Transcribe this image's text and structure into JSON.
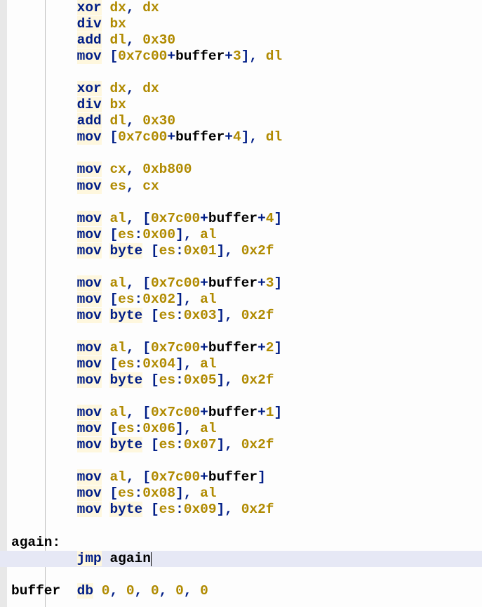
{
  "lines": [
    {
      "indent": 2,
      "tokens": [
        {
          "t": "xor",
          "c": "kw"
        },
        {
          "t": " "
        },
        {
          "t": "dx",
          "c": "reg"
        },
        {
          "t": ",",
          "c": "sym"
        },
        {
          "t": " "
        },
        {
          "t": "dx",
          "c": "reg"
        }
      ]
    },
    {
      "indent": 2,
      "tokens": [
        {
          "t": "div",
          "c": "kw"
        },
        {
          "t": " "
        },
        {
          "t": "bx",
          "c": "reg"
        }
      ]
    },
    {
      "indent": 2,
      "tokens": [
        {
          "t": "add",
          "c": "kw"
        },
        {
          "t": " "
        },
        {
          "t": "dl",
          "c": "reg"
        },
        {
          "t": ",",
          "c": "sym"
        },
        {
          "t": " "
        },
        {
          "t": "0x30",
          "c": "num"
        }
      ]
    },
    {
      "indent": 2,
      "tokens": [
        {
          "t": "mov",
          "c": "kw"
        },
        {
          "t": " "
        },
        {
          "t": "[",
          "c": "sym"
        },
        {
          "t": "0x7c00",
          "c": "num"
        },
        {
          "t": "+",
          "c": "sym"
        },
        {
          "t": "buffer",
          "c": "id"
        },
        {
          "t": "+",
          "c": "sym"
        },
        {
          "t": "3",
          "c": "num"
        },
        {
          "t": "],",
          "c": "sym"
        },
        {
          "t": " "
        },
        {
          "t": "dl",
          "c": "reg"
        }
      ]
    },
    {
      "indent": 0,
      "tokens": []
    },
    {
      "indent": 2,
      "tokens": [
        {
          "t": "xor",
          "c": "kw"
        },
        {
          "t": " "
        },
        {
          "t": "dx",
          "c": "reg"
        },
        {
          "t": ",",
          "c": "sym"
        },
        {
          "t": " "
        },
        {
          "t": "dx",
          "c": "reg"
        }
      ]
    },
    {
      "indent": 2,
      "tokens": [
        {
          "t": "div",
          "c": "kw"
        },
        {
          "t": " "
        },
        {
          "t": "bx",
          "c": "reg"
        }
      ]
    },
    {
      "indent": 2,
      "tokens": [
        {
          "t": "add",
          "c": "kw"
        },
        {
          "t": " "
        },
        {
          "t": "dl",
          "c": "reg"
        },
        {
          "t": ",",
          "c": "sym"
        },
        {
          "t": " "
        },
        {
          "t": "0x30",
          "c": "num"
        }
      ]
    },
    {
      "indent": 2,
      "tokens": [
        {
          "t": "mov",
          "c": "kw"
        },
        {
          "t": " "
        },
        {
          "t": "[",
          "c": "sym"
        },
        {
          "t": "0x7c00",
          "c": "num"
        },
        {
          "t": "+",
          "c": "sym"
        },
        {
          "t": "buffer",
          "c": "id"
        },
        {
          "t": "+",
          "c": "sym"
        },
        {
          "t": "4",
          "c": "num"
        },
        {
          "t": "],",
          "c": "sym"
        },
        {
          "t": " "
        },
        {
          "t": "dl",
          "c": "reg"
        }
      ]
    },
    {
      "indent": 0,
      "tokens": []
    },
    {
      "indent": 2,
      "tokens": [
        {
          "t": "mov",
          "c": "kw"
        },
        {
          "t": " "
        },
        {
          "t": "cx",
          "c": "reg"
        },
        {
          "t": ",",
          "c": "sym"
        },
        {
          "t": " "
        },
        {
          "t": "0xb800",
          "c": "num"
        }
      ]
    },
    {
      "indent": 2,
      "tokens": [
        {
          "t": "mov",
          "c": "kw"
        },
        {
          "t": " "
        },
        {
          "t": "es",
          "c": "reg"
        },
        {
          "t": ",",
          "c": "sym"
        },
        {
          "t": " "
        },
        {
          "t": "cx",
          "c": "reg"
        }
      ]
    },
    {
      "indent": 0,
      "tokens": []
    },
    {
      "indent": 2,
      "tokens": [
        {
          "t": "mov",
          "c": "kw"
        },
        {
          "t": " "
        },
        {
          "t": "al",
          "c": "reg"
        },
        {
          "t": ",",
          "c": "sym"
        },
        {
          "t": " "
        },
        {
          "t": "[",
          "c": "sym"
        },
        {
          "t": "0x7c00",
          "c": "num"
        },
        {
          "t": "+",
          "c": "sym"
        },
        {
          "t": "buffer",
          "c": "id"
        },
        {
          "t": "+",
          "c": "sym"
        },
        {
          "t": "4",
          "c": "num"
        },
        {
          "t": "]",
          "c": "sym"
        }
      ]
    },
    {
      "indent": 2,
      "tokens": [
        {
          "t": "mov",
          "c": "kw"
        },
        {
          "t": " "
        },
        {
          "t": "[",
          "c": "sym"
        },
        {
          "t": "es",
          "c": "reg"
        },
        {
          "t": ":",
          "c": "sym"
        },
        {
          "t": "0x00",
          "c": "num"
        },
        {
          "t": "],",
          "c": "sym"
        },
        {
          "t": " "
        },
        {
          "t": "al",
          "c": "reg"
        }
      ]
    },
    {
      "indent": 2,
      "tokens": [
        {
          "t": "mov",
          "c": "kw"
        },
        {
          "t": " "
        },
        {
          "t": "byte",
          "c": "kw"
        },
        {
          "t": " "
        },
        {
          "t": "[",
          "c": "sym"
        },
        {
          "t": "es",
          "c": "reg"
        },
        {
          "t": ":",
          "c": "sym"
        },
        {
          "t": "0x01",
          "c": "num"
        },
        {
          "t": "],",
          "c": "sym"
        },
        {
          "t": " "
        },
        {
          "t": "0x2f",
          "c": "num"
        }
      ]
    },
    {
      "indent": 0,
      "tokens": []
    },
    {
      "indent": 2,
      "tokens": [
        {
          "t": "mov",
          "c": "kw"
        },
        {
          "t": " "
        },
        {
          "t": "al",
          "c": "reg"
        },
        {
          "t": ",",
          "c": "sym"
        },
        {
          "t": " "
        },
        {
          "t": "[",
          "c": "sym"
        },
        {
          "t": "0x7c00",
          "c": "num"
        },
        {
          "t": "+",
          "c": "sym"
        },
        {
          "t": "buffer",
          "c": "id"
        },
        {
          "t": "+",
          "c": "sym"
        },
        {
          "t": "3",
          "c": "num"
        },
        {
          "t": "]",
          "c": "sym"
        }
      ]
    },
    {
      "indent": 2,
      "tokens": [
        {
          "t": "mov",
          "c": "kw"
        },
        {
          "t": " "
        },
        {
          "t": "[",
          "c": "sym"
        },
        {
          "t": "es",
          "c": "reg"
        },
        {
          "t": ":",
          "c": "sym"
        },
        {
          "t": "0x02",
          "c": "num"
        },
        {
          "t": "],",
          "c": "sym"
        },
        {
          "t": " "
        },
        {
          "t": "al",
          "c": "reg"
        }
      ]
    },
    {
      "indent": 2,
      "tokens": [
        {
          "t": "mov",
          "c": "kw"
        },
        {
          "t": " "
        },
        {
          "t": "byte",
          "c": "kw"
        },
        {
          "t": " "
        },
        {
          "t": "[",
          "c": "sym"
        },
        {
          "t": "es",
          "c": "reg"
        },
        {
          "t": ":",
          "c": "sym"
        },
        {
          "t": "0x03",
          "c": "num"
        },
        {
          "t": "],",
          "c": "sym"
        },
        {
          "t": " "
        },
        {
          "t": "0x2f",
          "c": "num"
        }
      ]
    },
    {
      "indent": 0,
      "tokens": []
    },
    {
      "indent": 2,
      "tokens": [
        {
          "t": "mov",
          "c": "kw"
        },
        {
          "t": " "
        },
        {
          "t": "al",
          "c": "reg"
        },
        {
          "t": ",",
          "c": "sym"
        },
        {
          "t": " "
        },
        {
          "t": "[",
          "c": "sym"
        },
        {
          "t": "0x7c00",
          "c": "num"
        },
        {
          "t": "+",
          "c": "sym"
        },
        {
          "t": "buffer",
          "c": "id"
        },
        {
          "t": "+",
          "c": "sym"
        },
        {
          "t": "2",
          "c": "num"
        },
        {
          "t": "]",
          "c": "sym"
        }
      ]
    },
    {
      "indent": 2,
      "tokens": [
        {
          "t": "mov",
          "c": "kw"
        },
        {
          "t": " "
        },
        {
          "t": "[",
          "c": "sym"
        },
        {
          "t": "es",
          "c": "reg"
        },
        {
          "t": ":",
          "c": "sym"
        },
        {
          "t": "0x04",
          "c": "num"
        },
        {
          "t": "],",
          "c": "sym"
        },
        {
          "t": " "
        },
        {
          "t": "al",
          "c": "reg"
        }
      ]
    },
    {
      "indent": 2,
      "tokens": [
        {
          "t": "mov",
          "c": "kw"
        },
        {
          "t": " "
        },
        {
          "t": "byte",
          "c": "kw"
        },
        {
          "t": " "
        },
        {
          "t": "[",
          "c": "sym"
        },
        {
          "t": "es",
          "c": "reg"
        },
        {
          "t": ":",
          "c": "sym"
        },
        {
          "t": "0x05",
          "c": "num"
        },
        {
          "t": "],",
          "c": "sym"
        },
        {
          "t": " "
        },
        {
          "t": "0x2f",
          "c": "num"
        }
      ]
    },
    {
      "indent": 0,
      "tokens": []
    },
    {
      "indent": 2,
      "tokens": [
        {
          "t": "mov",
          "c": "kw"
        },
        {
          "t": " "
        },
        {
          "t": "al",
          "c": "reg"
        },
        {
          "t": ",",
          "c": "sym"
        },
        {
          "t": " "
        },
        {
          "t": "[",
          "c": "sym"
        },
        {
          "t": "0x7c00",
          "c": "num"
        },
        {
          "t": "+",
          "c": "sym"
        },
        {
          "t": "buffer",
          "c": "id"
        },
        {
          "t": "+",
          "c": "sym"
        },
        {
          "t": "1",
          "c": "num"
        },
        {
          "t": "]",
          "c": "sym"
        }
      ]
    },
    {
      "indent": 2,
      "tokens": [
        {
          "t": "mov",
          "c": "kw"
        },
        {
          "t": " "
        },
        {
          "t": "[",
          "c": "sym"
        },
        {
          "t": "es",
          "c": "reg"
        },
        {
          "t": ":",
          "c": "sym"
        },
        {
          "t": "0x06",
          "c": "num"
        },
        {
          "t": "],",
          "c": "sym"
        },
        {
          "t": " "
        },
        {
          "t": "al",
          "c": "reg"
        }
      ]
    },
    {
      "indent": 2,
      "tokens": [
        {
          "t": "mov",
          "c": "kw"
        },
        {
          "t": " "
        },
        {
          "t": "byte",
          "c": "kw"
        },
        {
          "t": " "
        },
        {
          "t": "[",
          "c": "sym"
        },
        {
          "t": "es",
          "c": "reg"
        },
        {
          "t": ":",
          "c": "sym"
        },
        {
          "t": "0x07",
          "c": "num"
        },
        {
          "t": "],",
          "c": "sym"
        },
        {
          "t": " "
        },
        {
          "t": "0x2f",
          "c": "num"
        }
      ]
    },
    {
      "indent": 0,
      "tokens": []
    },
    {
      "indent": 2,
      "tokens": [
        {
          "t": "mov",
          "c": "kw"
        },
        {
          "t": " "
        },
        {
          "t": "al",
          "c": "reg"
        },
        {
          "t": ",",
          "c": "sym"
        },
        {
          "t": " "
        },
        {
          "t": "[",
          "c": "sym"
        },
        {
          "t": "0x7c00",
          "c": "num"
        },
        {
          "t": "+",
          "c": "sym"
        },
        {
          "t": "buffer",
          "c": "id"
        },
        {
          "t": "]",
          "c": "sym"
        }
      ]
    },
    {
      "indent": 2,
      "tokens": [
        {
          "t": "mov",
          "c": "kw"
        },
        {
          "t": " "
        },
        {
          "t": "[",
          "c": "sym"
        },
        {
          "t": "es",
          "c": "reg"
        },
        {
          "t": ":",
          "c": "sym"
        },
        {
          "t": "0x08",
          "c": "num"
        },
        {
          "t": "],",
          "c": "sym"
        },
        {
          "t": " "
        },
        {
          "t": "al",
          "c": "reg"
        }
      ]
    },
    {
      "indent": 2,
      "tokens": [
        {
          "t": "mov",
          "c": "kw"
        },
        {
          "t": " "
        },
        {
          "t": "byte",
          "c": "kw"
        },
        {
          "t": " "
        },
        {
          "t": "[",
          "c": "sym"
        },
        {
          "t": "es",
          "c": "reg"
        },
        {
          "t": ":",
          "c": "sym"
        },
        {
          "t": "0x09",
          "c": "num"
        },
        {
          "t": "],",
          "c": "sym"
        },
        {
          "t": " "
        },
        {
          "t": "0x2f",
          "c": "num"
        }
      ]
    },
    {
      "indent": 0,
      "tokens": []
    },
    {
      "indent": 0,
      "tokens": [
        {
          "t": "again:",
          "c": "id"
        }
      ]
    },
    {
      "indent": 2,
      "current": true,
      "cursor": true,
      "tokens": [
        {
          "t": "jmp",
          "c": "kw"
        },
        {
          "t": " "
        },
        {
          "t": "again",
          "c": "id"
        }
      ]
    },
    {
      "indent": 0,
      "tokens": []
    },
    {
      "indent": 0,
      "tokens": [
        {
          "t": "buffer",
          "c": "id"
        },
        {
          "t": "  "
        },
        {
          "t": "db",
          "c": "kw"
        },
        {
          "t": " "
        },
        {
          "t": "0",
          "c": "num"
        },
        {
          "t": ",",
          "c": "sym"
        },
        {
          "t": " "
        },
        {
          "t": "0",
          "c": "num"
        },
        {
          "t": ",",
          "c": "sym"
        },
        {
          "t": " "
        },
        {
          "t": "0",
          "c": "num"
        },
        {
          "t": ",",
          "c": "sym"
        },
        {
          "t": " "
        },
        {
          "t": "0",
          "c": "num"
        },
        {
          "t": ",",
          "c": "sym"
        },
        {
          "t": " "
        },
        {
          "t": "0",
          "c": "num"
        }
      ]
    }
  ]
}
